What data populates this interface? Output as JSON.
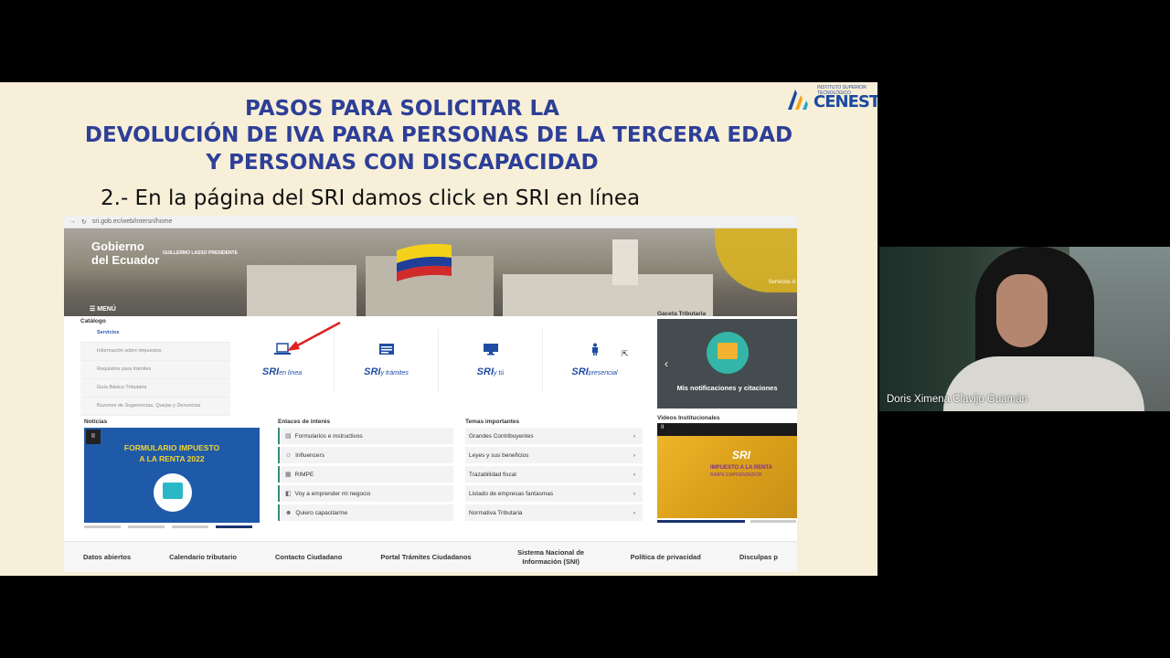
{
  "slide": {
    "title_line1": "PASOS PARA SOLICITAR LA",
    "title_line2": "DEVOLUCIÓN DE IVA PARA PERSONAS DE LA TERCERA EDAD",
    "title_line3": "Y PERSONAS CON DISCAPACIDAD",
    "step": "2.- En la página del SRI  damos click en SRI en línea",
    "logo_small": "INSTITUTO SUPERIOR TECNOLÓGICO",
    "logo_word": "CENESTUR"
  },
  "browser": {
    "url": "sri.gob.ec/web/intersri/home",
    "gov_line1": "Gobierno",
    "gov_line2": "del Ecuador",
    "gov_sub": "GUILLERMO LASSO PRESIDENTE",
    "menu_label": "☰ MENÚ",
    "hero_right_text": "Servicios d",
    "catalog": {
      "label": "Catálogo",
      "items": [
        "Servicios",
        "Información sobre impuestos",
        "Requisitos para trámites",
        "Guía Básica Tributaria",
        "Buzones de Sugerencias, Quejas y Denuncias"
      ]
    },
    "tiles": [
      {
        "label": "SRI",
        "sub": "en línea",
        "icon": "laptop-icon"
      },
      {
        "label": "SRI",
        "sub": "y trámites",
        "icon": "form-icon"
      },
      {
        "label": "SRI",
        "sub": "y tú",
        "icon": "monitor-icon"
      },
      {
        "label": "SRI",
        "sub": "presencial",
        "icon": "person-icon"
      }
    ],
    "gaceta": {
      "label": "Gaceta Tributaria",
      "caption": "Mis notificaciones y citaciones",
      "prev_arrow": "‹"
    },
    "noticias": {
      "label": "Noticias",
      "banner_line1": "FORMULARIO IMPUESTO",
      "banner_line2": "A LA RENTA 2022",
      "pause": "II"
    },
    "enlaces": {
      "label": "Enlaces de interés",
      "items": [
        "Formularios e instructivos",
        "Influencers",
        "RIMPE",
        "Voy a emprender mi negocio",
        "Quiero capacitarme"
      ]
    },
    "temas": {
      "label": "Temas importantes",
      "items": [
        "Grandes Contribuyentes",
        "Leyes y sus beneficios",
        "Trazabilidad fiscal",
        "Listado de empresas fantasmas",
        "Normativa Tributaria"
      ],
      "chevron": "›"
    },
    "videos": {
      "label": "Videos Institucionales",
      "logo": "SRI",
      "line1": "IMPUESTO A LA RENTA",
      "line2": "RIMPE EMPRENDEDOR",
      "pause": "II"
    },
    "footer": [
      "Datos abiertos",
      "Calendario tributario",
      "Contacto Ciudadano",
      "Portal Trámites Ciudadanos",
      "Sistema Nacional de Información (SNI)",
      "Política de privacidad",
      "Disculpas p"
    ]
  },
  "participant": {
    "name": "Doris Ximena Clavijo Guamán"
  },
  "colors": {
    "slide_bg": "#f7efd8",
    "title_blue": "#2d3f97",
    "sri_blue": "#1f4da3",
    "accent_teal": "#3a8b7c"
  }
}
